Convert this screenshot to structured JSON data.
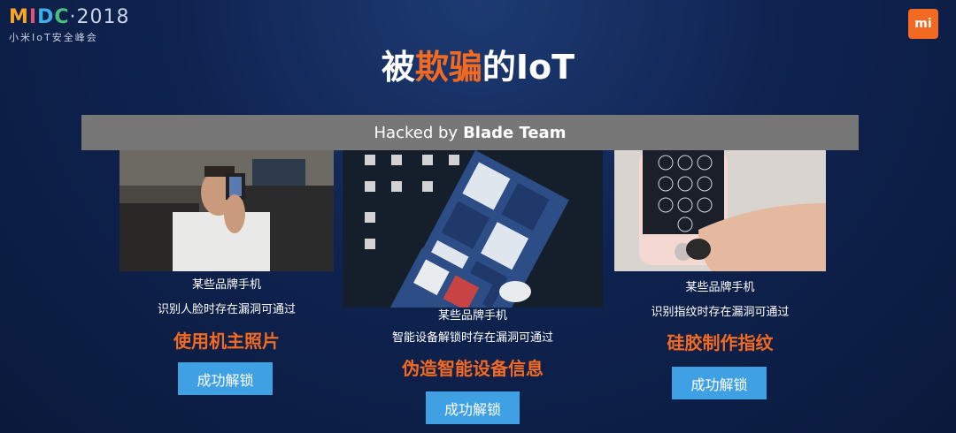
{
  "header": {
    "logo_mark": "MIDC",
    "logo_year": "·2018",
    "logo_sub": "小米IoT安全峰会",
    "brand_badge": "mi",
    "title_pre": "被",
    "title_highlight": "欺骗",
    "title_post": "的IoT"
  },
  "banner": {
    "text_pre": "Hacked by",
    "text_bold": "Blade Team"
  },
  "cards": [
    {
      "line1": "某些品牌手机",
      "line2": "识别人脸时存在漏洞可通过",
      "method": "使用机主照片",
      "button": "成功解锁"
    },
    {
      "line1": "某些品牌手机",
      "line2": "智能设备解锁时存在漏洞可通过",
      "method": "伪造智能设备信息",
      "button": "成功解锁"
    },
    {
      "line1": "某些品牌手机",
      "line2": "识别指纹时存在漏洞可通过",
      "method": "硅胶制作指纹",
      "button": "成功解锁"
    }
  ],
  "colors": {
    "accent": "#f26a21",
    "button": "#3fa0e3",
    "banner": "#777777",
    "background": "#0f2350"
  }
}
